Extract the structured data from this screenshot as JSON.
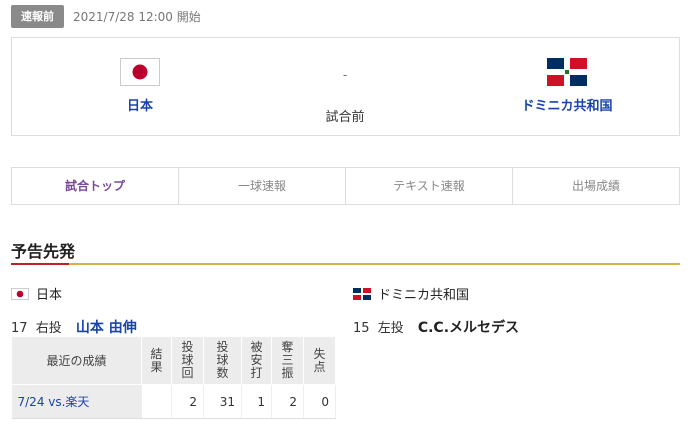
{
  "status": {
    "badge": "速報前",
    "datetime": "2021/7/28 12:00 開始"
  },
  "match": {
    "home": {
      "name": "日本"
    },
    "away": {
      "name": "ドミニカ共和国"
    },
    "score": "-",
    "state": "試合前"
  },
  "tabs": [
    {
      "label": "試合トップ"
    },
    {
      "label": "一球速報"
    },
    {
      "label": "テキスト速報"
    },
    {
      "label": "出場成績"
    }
  ],
  "section": {
    "title": "予告先発"
  },
  "home_pitcher": {
    "country": "日本",
    "number": "17",
    "hand": "右投",
    "name": "山本 由伸"
  },
  "away_pitcher": {
    "country": "ドミニカ共和国",
    "number": "15",
    "hand": "左投",
    "name": "C.C.メルセデス"
  },
  "stats_table": {
    "headers": [
      "最近の成績",
      "結果",
      "投球回",
      "投球数",
      "被安打",
      "奪三振",
      "失点"
    ],
    "rows": [
      {
        "game": "7/24 vs.楽天",
        "result": "",
        "innings": "2",
        "pitches": "31",
        "hits": "1",
        "strikeouts": "2",
        "runs": "0"
      }
    ]
  },
  "colors": {
    "link": "#1a44a8",
    "accent_gold": "#d4b44a",
    "accent_red": "#c0202a",
    "active_tab": "#7a4a9a"
  }
}
